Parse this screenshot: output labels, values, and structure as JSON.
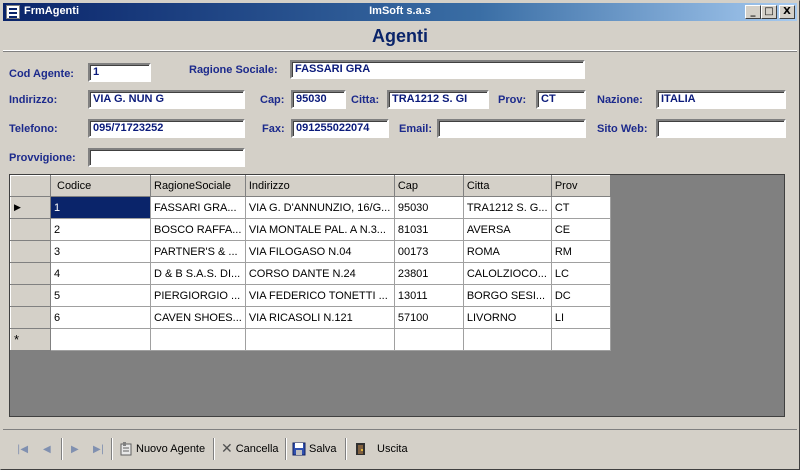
{
  "window": {
    "title": "FrmAgenti",
    "center_title": "ImSoft s.a.s",
    "minimize": "_",
    "maximize": "□",
    "close": "X"
  },
  "header": {
    "title": "Agenti"
  },
  "form": {
    "cod_agente": {
      "label": "Cod Agente:",
      "value": "1"
    },
    "ragione_sociale": {
      "label": "Ragione Sociale:",
      "value": "FASSARI GRA"
    },
    "indirizzo": {
      "label": "Indirizzo:",
      "value": "VIA G. NUN G"
    },
    "cap": {
      "label": "Cap:",
      "value": "95030"
    },
    "citta": {
      "label": "Citta:",
      "value": "TRA1212 S. GI"
    },
    "prov": {
      "label": "Prov:",
      "value": "CT"
    },
    "nazione": {
      "label": "Nazione:",
      "value": "ITALIA"
    },
    "telefono": {
      "label": "Telefono:",
      "value": "095/71723252"
    },
    "fax": {
      "label": "Fax:",
      "value": "091255022074"
    },
    "email": {
      "label": "Email:",
      "value": ""
    },
    "sito_web": {
      "label": "Sito Web:",
      "value": ""
    },
    "provvigione": {
      "label": "Provvigione:",
      "value": ""
    }
  },
  "grid": {
    "columns": [
      "Codice",
      "RagioneSociale",
      "Indirizzo",
      "Cap",
      "Citta",
      "Prov"
    ],
    "current_marker": "▶",
    "new_marker": "*",
    "rows": [
      {
        "codice": "1",
        "ragione": "FASSARI GRA...",
        "indirizzo": "VIA G. D'ANNUNZIO, 16/G...",
        "cap": "95030",
        "citta": "TRA1212 S. G...",
        "prov": "CT"
      },
      {
        "codice": "2",
        "ragione": "BOSCO RAFFA...",
        "indirizzo": "VIA MONTALE PAL. A N.3...",
        "cap": "81031",
        "citta": "AVERSA",
        "prov": "CE"
      },
      {
        "codice": "3",
        "ragione": "PARTNER'S & ...",
        "indirizzo": "VIA FILOGASO N.04",
        "cap": "00173",
        "citta": "ROMA",
        "prov": "RM"
      },
      {
        "codice": "4",
        "ragione": "D & B S.A.S. DI...",
        "indirizzo": "CORSO DANTE N.24",
        "cap": "23801",
        "citta": "CALOLZIOCO...",
        "prov": "LC"
      },
      {
        "codice": "5",
        "ragione": "PIERGIORGIO ...",
        "indirizzo": "VIA FEDERICO TONETTI ...",
        "cap": "13011",
        "citta": "BORGO SESI...",
        "prov": "DC"
      },
      {
        "codice": "6",
        "ragione": "CAVEN SHOES...",
        "indirizzo": "VIA RICASOLI N.121",
        "cap": "57100",
        "citta": "LIVORNO",
        "prov": "LI"
      }
    ],
    "ellipsis": "..."
  },
  "toolbar": {
    "first": "|◀",
    "prev": "◀",
    "next": "▶",
    "last": "▶|",
    "nuovo": "Nuovo Agente",
    "cancella": "Cancella",
    "salva": "Salva",
    "uscita": "Uscita"
  }
}
